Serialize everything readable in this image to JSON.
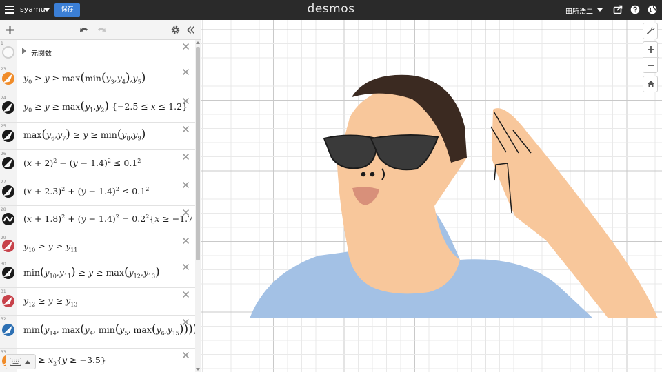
{
  "header": {
    "graph_title": "syamu",
    "save_label": "保存",
    "brand": "desmos",
    "user_name": "田所浩二"
  },
  "expressions": [
    {
      "num": "1",
      "type": "folder",
      "label": "元関数"
    },
    {
      "num": "23",
      "color": "#f08c2a",
      "style": "line"
    },
    {
      "num": "24",
      "color": "#1a1a1a",
      "style": "line"
    },
    {
      "num": "25",
      "color": "#1a1a1a",
      "style": "line"
    },
    {
      "num": "26",
      "color": "#1a1a1a",
      "style": "line"
    },
    {
      "num": "27",
      "color": "#1a1a1a",
      "style": "line"
    },
    {
      "num": "28",
      "color": "#1a1a1a",
      "style": "wave"
    },
    {
      "num": "29",
      "color": "#c7424a",
      "style": "line"
    },
    {
      "num": "30",
      "color": "#1a1a1a",
      "style": "line"
    },
    {
      "num": "31",
      "color": "#c7424a",
      "style": "line"
    },
    {
      "num": "32",
      "color": "#2d70b3",
      "style": "line"
    },
    {
      "num": "33",
      "color": "#f08c2a",
      "style": "line"
    }
  ],
  "colors": {
    "skin": "#f8c79b",
    "hair": "#3b2a21",
    "shirt": "#a3c1e5",
    "sunglasses": "#3a3a3a",
    "lips": "#d8907a",
    "accent_blue": "#3b7fd6"
  },
  "icons": [
    "menu-icon",
    "plus-icon",
    "undo-icon",
    "redo-icon",
    "gear-icon",
    "collapse-icon",
    "share-icon",
    "help-icon",
    "globe-icon",
    "wrench-icon",
    "zoom-in-icon",
    "zoom-out-icon",
    "home-icon",
    "close-icon",
    "keyboard-icon"
  ]
}
